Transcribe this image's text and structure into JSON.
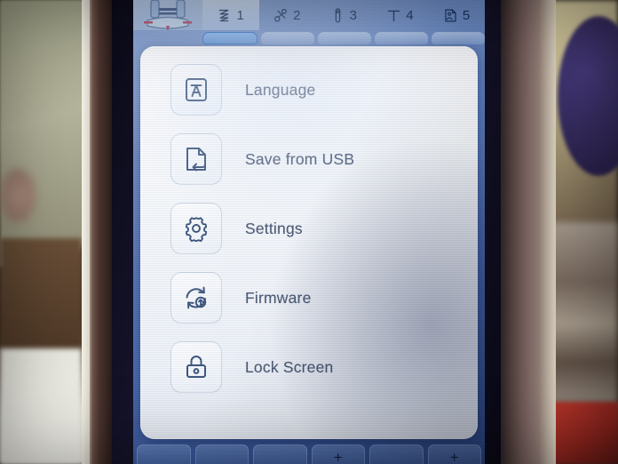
{
  "device": {
    "type": "sewing-machine-touchscreen",
    "screen_label": "LCD touch panel"
  },
  "topbar": {
    "presser_foot_icon": "presser-foot-icon",
    "tabs": [
      {
        "number": "1",
        "icon": "zigzag-stitch-icon",
        "active": true
      },
      {
        "number": "2",
        "icon": "scissors-icon",
        "active": false
      },
      {
        "number": "3",
        "icon": "needle-icon",
        "active": false
      },
      {
        "number": "4",
        "icon": "text-letter-t-icon",
        "active": false
      },
      {
        "number": "5",
        "icon": "document-person-icon",
        "active": false
      }
    ]
  },
  "pillrow": {
    "items": [
      {
        "selected": true
      },
      {
        "selected": false
      },
      {
        "selected": false
      },
      {
        "selected": false
      },
      {
        "selected": false
      }
    ]
  },
  "menu": {
    "items": [
      {
        "label": "Language",
        "icon": "language-character-icon"
      },
      {
        "label": "Save from USB",
        "icon": "document-import-icon"
      },
      {
        "label": "Settings",
        "icon": "gear-icon"
      },
      {
        "label": "Firmware",
        "icon": "update-refresh-icon"
      },
      {
        "label": "Lock Screen",
        "icon": "padlock-icon"
      }
    ]
  },
  "bottombar": {
    "buttons": [
      {
        "glyph": ""
      },
      {
        "glyph": ""
      },
      {
        "glyph": ""
      },
      {
        "glyph": "+"
      },
      {
        "glyph": ""
      },
      {
        "glyph": "+"
      }
    ]
  },
  "colors": {
    "lcd_blue": "#4e6fb5",
    "card_white": "#f7f9fc",
    "icon_navy": "#2a4570",
    "label_slate": "#3a4a66",
    "accent_blue": "#2f6fc4"
  }
}
